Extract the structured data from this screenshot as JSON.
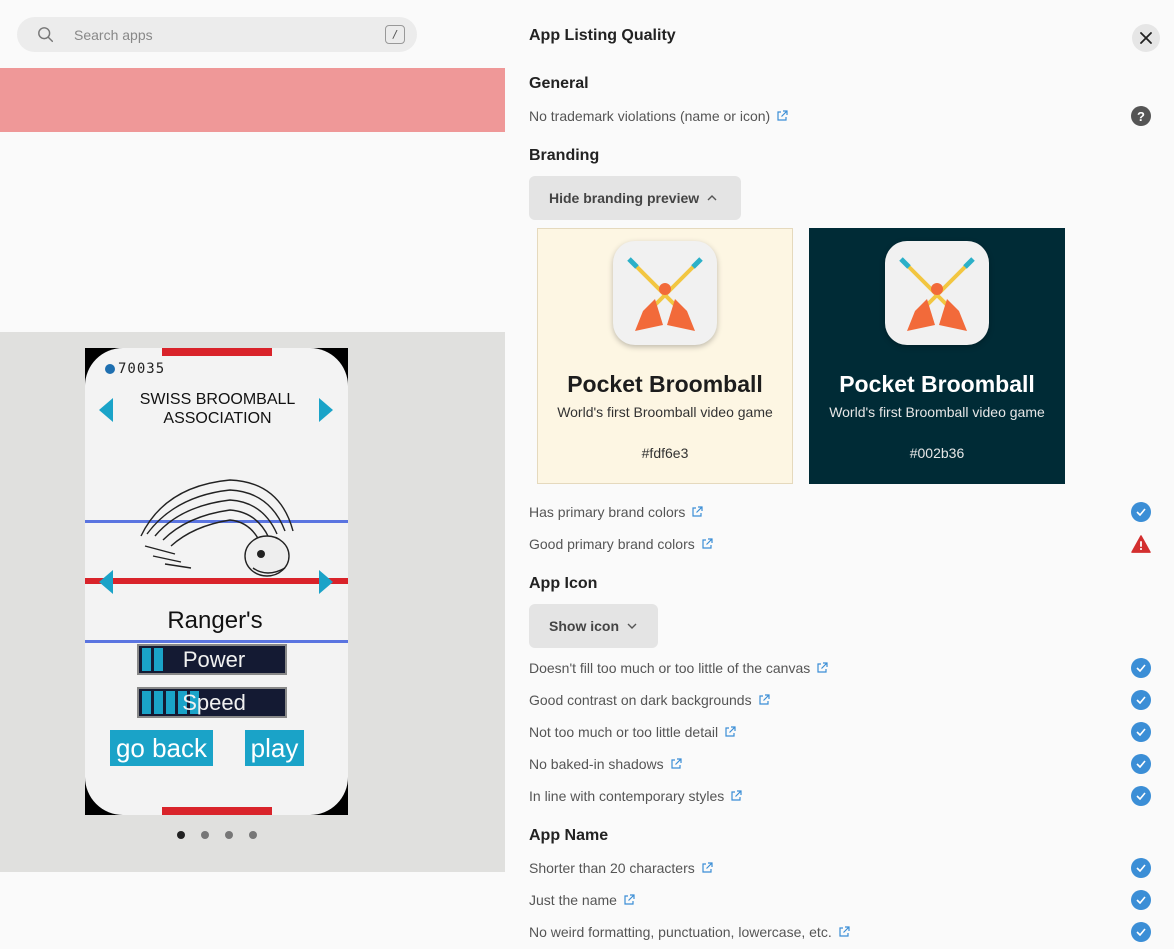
{
  "search": {
    "placeholder": "Search apps",
    "shortcut": "/"
  },
  "screenshot": {
    "score": "70035",
    "association": "SWISS BROOMBALL ASSOCIATION",
    "team": "Ranger's",
    "power_label": "Power",
    "speed_label": "Speed",
    "back_label": "go back",
    "play_label": "play",
    "page_count": 4,
    "active_page": 1
  },
  "panel": {
    "title": "App Listing Quality",
    "close_icon": "close-icon",
    "sections": {
      "general": "General",
      "branding": "Branding",
      "app_icon": "App Icon",
      "app_name": "App Name"
    },
    "general_items": [
      {
        "label": "No trademark violations (name or icon)",
        "status": "unknown"
      }
    ],
    "branding_toggle": "Hide branding preview",
    "branding_preview": {
      "app_name": "Pocket Broomball",
      "tagline": "World's first Broomball video game",
      "light_color": "#fdf6e3",
      "dark_color": "#002b36"
    },
    "branding_items": [
      {
        "label": "Has primary brand colors",
        "status": "pass"
      },
      {
        "label": "Good primary brand colors",
        "status": "warning"
      }
    ],
    "icon_toggle": "Show icon",
    "icon_items": [
      {
        "label": "Doesn't fill too much or too little of the canvas",
        "status": "pass"
      },
      {
        "label": "Good contrast on dark backgrounds",
        "status": "pass"
      },
      {
        "label": "Not too much or too little detail",
        "status": "pass"
      },
      {
        "label": "No baked-in shadows",
        "status": "pass"
      },
      {
        "label": "In line with contemporary styles",
        "status": "pass"
      }
    ],
    "name_items": [
      {
        "label": "Shorter than 20 characters",
        "status": "pass"
      },
      {
        "label": "Just the name",
        "status": "pass"
      },
      {
        "label": "No weird formatting, punctuation, lowercase, etc.",
        "status": "pass"
      }
    ],
    "colors": {
      "check": "#3b8ed6",
      "warning": "#d32f2f",
      "pink_band": "#ef9898"
    }
  }
}
